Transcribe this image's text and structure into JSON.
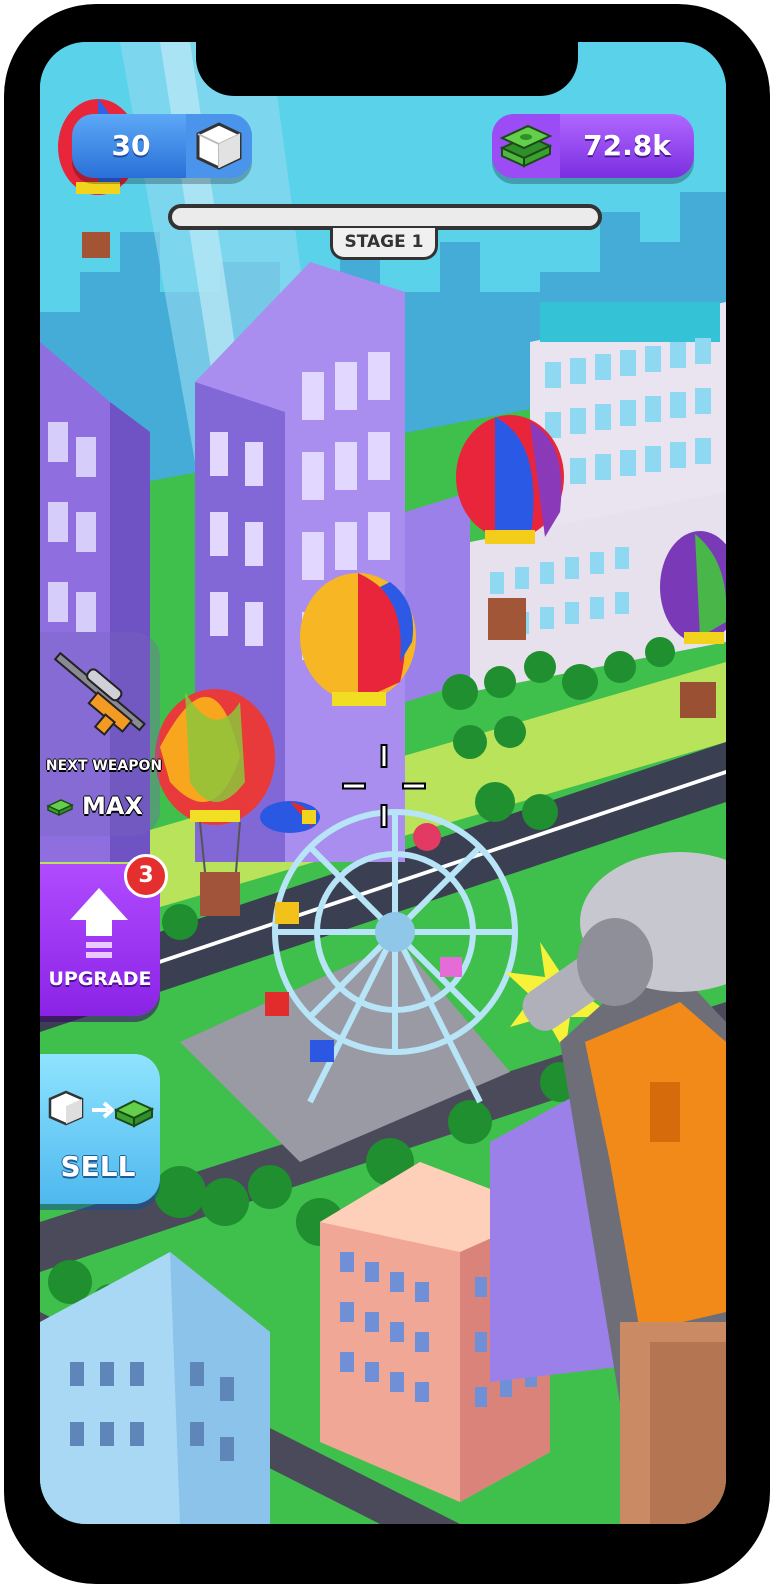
{
  "hud": {
    "gem_count": "30",
    "cash_amount": "72.8k",
    "stage_label": "STAGE 1",
    "stage_progress": 0
  },
  "side_panel": {
    "next_weapon_label": "NEXT WEAPON",
    "next_weapon_cost": "MAX",
    "upgrade_label": "UPGRADE",
    "upgrade_badge": "3",
    "sell_label": "SELL"
  },
  "icons": {
    "gem": "white-cube-icon",
    "cash": "cash-stack-icon",
    "upgrade": "up-arrow-icon",
    "weapon": "sniper-rifle-icon",
    "crosshair": "crosshair-icon"
  },
  "colors": {
    "gem_pill": "#3d8ae8",
    "cash_pill": "#9a45f2",
    "upgrade": "#a23cf6",
    "sell": "#6ccdf7",
    "badge": "#e52f2f",
    "progress_fill": "#4fc35a"
  }
}
